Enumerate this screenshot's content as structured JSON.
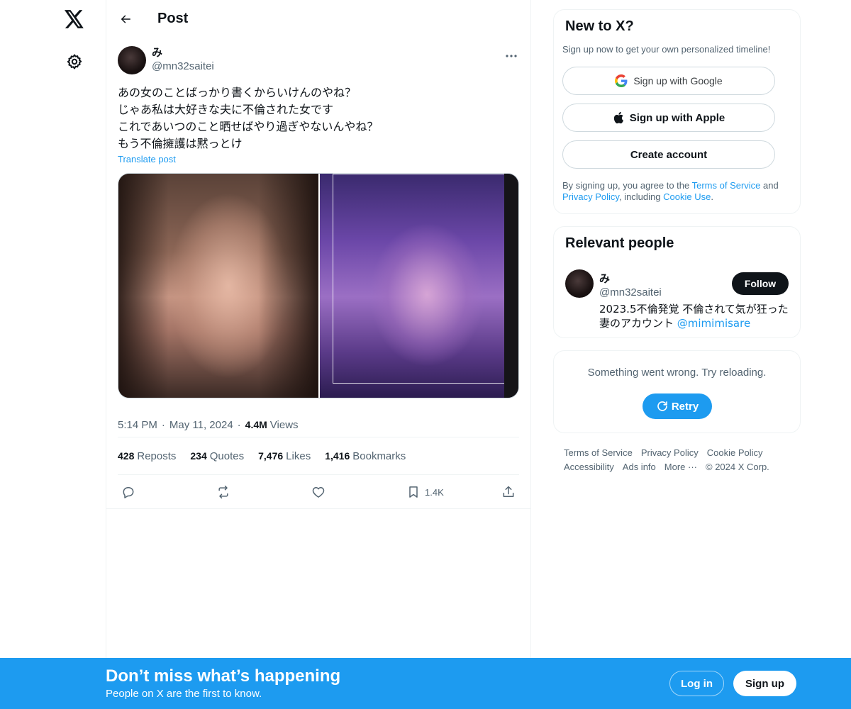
{
  "header": {
    "title": "Post"
  },
  "post": {
    "author_name": "み",
    "author_handle": "@mn32saitei",
    "text_lines": [
      "あの女のことばっかり書くからいけんのやね？",
      "じゃあ私は大好きな夫に不倫された女です",
      "これであいつのこと晒せばやり過ぎやないんやね？",
      "もう不倫擁護は黙っとけ"
    ],
    "translate_label": "Translate post",
    "time": "5:14 PM",
    "date": "May 11, 2024",
    "sep": "·",
    "views_count": "4.4M",
    "views_label": "Views",
    "stats": {
      "reposts_count": "428",
      "reposts_label": "Reposts",
      "quotes_count": "234",
      "quotes_label": "Quotes",
      "likes_count": "7,476",
      "likes_label": "Likes",
      "bookmarks_count": "1,416",
      "bookmarks_label": "Bookmarks"
    },
    "actions": {
      "bookmark_count": "1.4K"
    }
  },
  "sidebar": {
    "new_to_x": {
      "title": "New to X?",
      "subtitle": "Sign up now to get your own personalized timeline!",
      "google_label": "Sign up with Google",
      "apple_label": "Sign up with Apple",
      "create_label": "Create account",
      "legal_prefix": "By signing up, you agree to the ",
      "terms": "Terms of Service",
      "and": " and",
      "privacy": "Privacy Policy",
      "including": ", including ",
      "cookie": "Cookie Use",
      "period": "."
    },
    "relevant": {
      "title": "Relevant people",
      "name": "み",
      "handle": "@mn32saitei",
      "follow_label": "Follow",
      "bio": "2023.5不倫発覚 不倫されて気が狂った妻のアカウント ",
      "bio_mention": "@mimimisare"
    },
    "error": {
      "text": "Something went wrong. Try reloading.",
      "retry_label": "Retry"
    },
    "footer": {
      "terms": "Terms of Service",
      "privacy": "Privacy Policy",
      "cookie": "Cookie Policy",
      "accessibility": "Accessibility",
      "ads": "Ads info",
      "more": "More ···",
      "copyright": "© 2024 X Corp."
    }
  },
  "bottom_bar": {
    "title": "Don’t miss what’s happening",
    "subtitle": "People on X are the first to know.",
    "login_label": "Log in",
    "signup_label": "Sign up"
  },
  "colors": {
    "accent": "#1d9bf0",
    "text": "#0f1419",
    "muted": "#536471",
    "border": "#eff3f4"
  },
  "icons": [
    "x-logo-icon",
    "gear-icon",
    "back-arrow-icon",
    "more-icon",
    "reply-icon",
    "repost-icon",
    "like-icon",
    "bookmark-icon",
    "share-icon",
    "google-icon",
    "apple-icon",
    "retry-icon"
  ]
}
